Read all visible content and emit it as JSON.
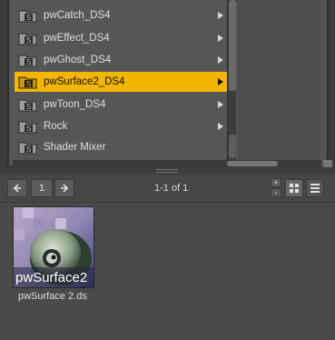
{
  "tree": {
    "items": [
      {
        "label": "pwCatch_DS4",
        "selected": false
      },
      {
        "label": "pwEffect_DS4",
        "selected": false
      },
      {
        "label": "pwGhost_DS4",
        "selected": false
      },
      {
        "label": "pwSurface2_DS4",
        "selected": true
      },
      {
        "label": "pwToon_DS4",
        "selected": false
      },
      {
        "label": "Rock",
        "selected": false
      },
      {
        "label": "Shader Mixer",
        "selected": false
      }
    ],
    "selected_color": "#f2b600"
  },
  "pager": {
    "prev_icon": "arrow-left-icon",
    "page": "1",
    "next_icon": "arrow-right-icon",
    "count_text": "1-1 of 1"
  },
  "zoom": {
    "plus": "+",
    "minus": "-"
  },
  "views": {
    "grid_icon": "grid-view-icon",
    "list_icon": "list-view-icon"
  },
  "content": {
    "items": [
      {
        "caption": "pwSurface 2.ds",
        "thumb_text": "pwSurface2"
      }
    ]
  }
}
